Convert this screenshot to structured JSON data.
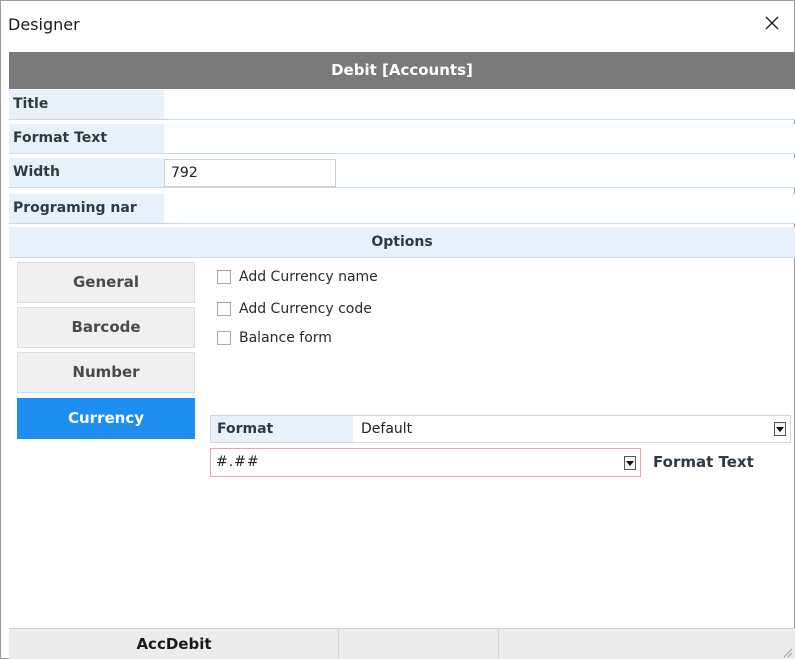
{
  "window": {
    "title": "Designer"
  },
  "header": {
    "title": "Debit [Accounts]"
  },
  "properties": {
    "title": {
      "label": "Title",
      "value": ""
    },
    "format_text": {
      "label": "Format Text",
      "value": ""
    },
    "width": {
      "label": "Width",
      "value": "792"
    },
    "programing_name": {
      "label": "Programing nar",
      "value": ""
    }
  },
  "options": {
    "title": "Options",
    "tabs": [
      {
        "label": "General",
        "active": false
      },
      {
        "label": "Barcode",
        "active": false
      },
      {
        "label": "Number",
        "active": false
      },
      {
        "label": "Currency",
        "active": true
      }
    ],
    "checkboxes": [
      {
        "label": "Add Currency name",
        "checked": false
      },
      {
        "label": "Add Currency code",
        "checked": false
      },
      {
        "label": "Balance form",
        "checked": false
      }
    ],
    "format": {
      "label": "Format",
      "value": "Default"
    },
    "pattern": {
      "value": "#.##",
      "label": "Format Text"
    }
  },
  "statusbar": {
    "name": "AccDebit"
  },
  "colors": {
    "accent": "#1e8fef",
    "header": "#7a7a7a",
    "label_bg": "#e6f1fb"
  },
  "icons": {
    "close": "close-icon",
    "dropdown": "chevron-down-icon",
    "grip": "resize-grip-icon"
  }
}
